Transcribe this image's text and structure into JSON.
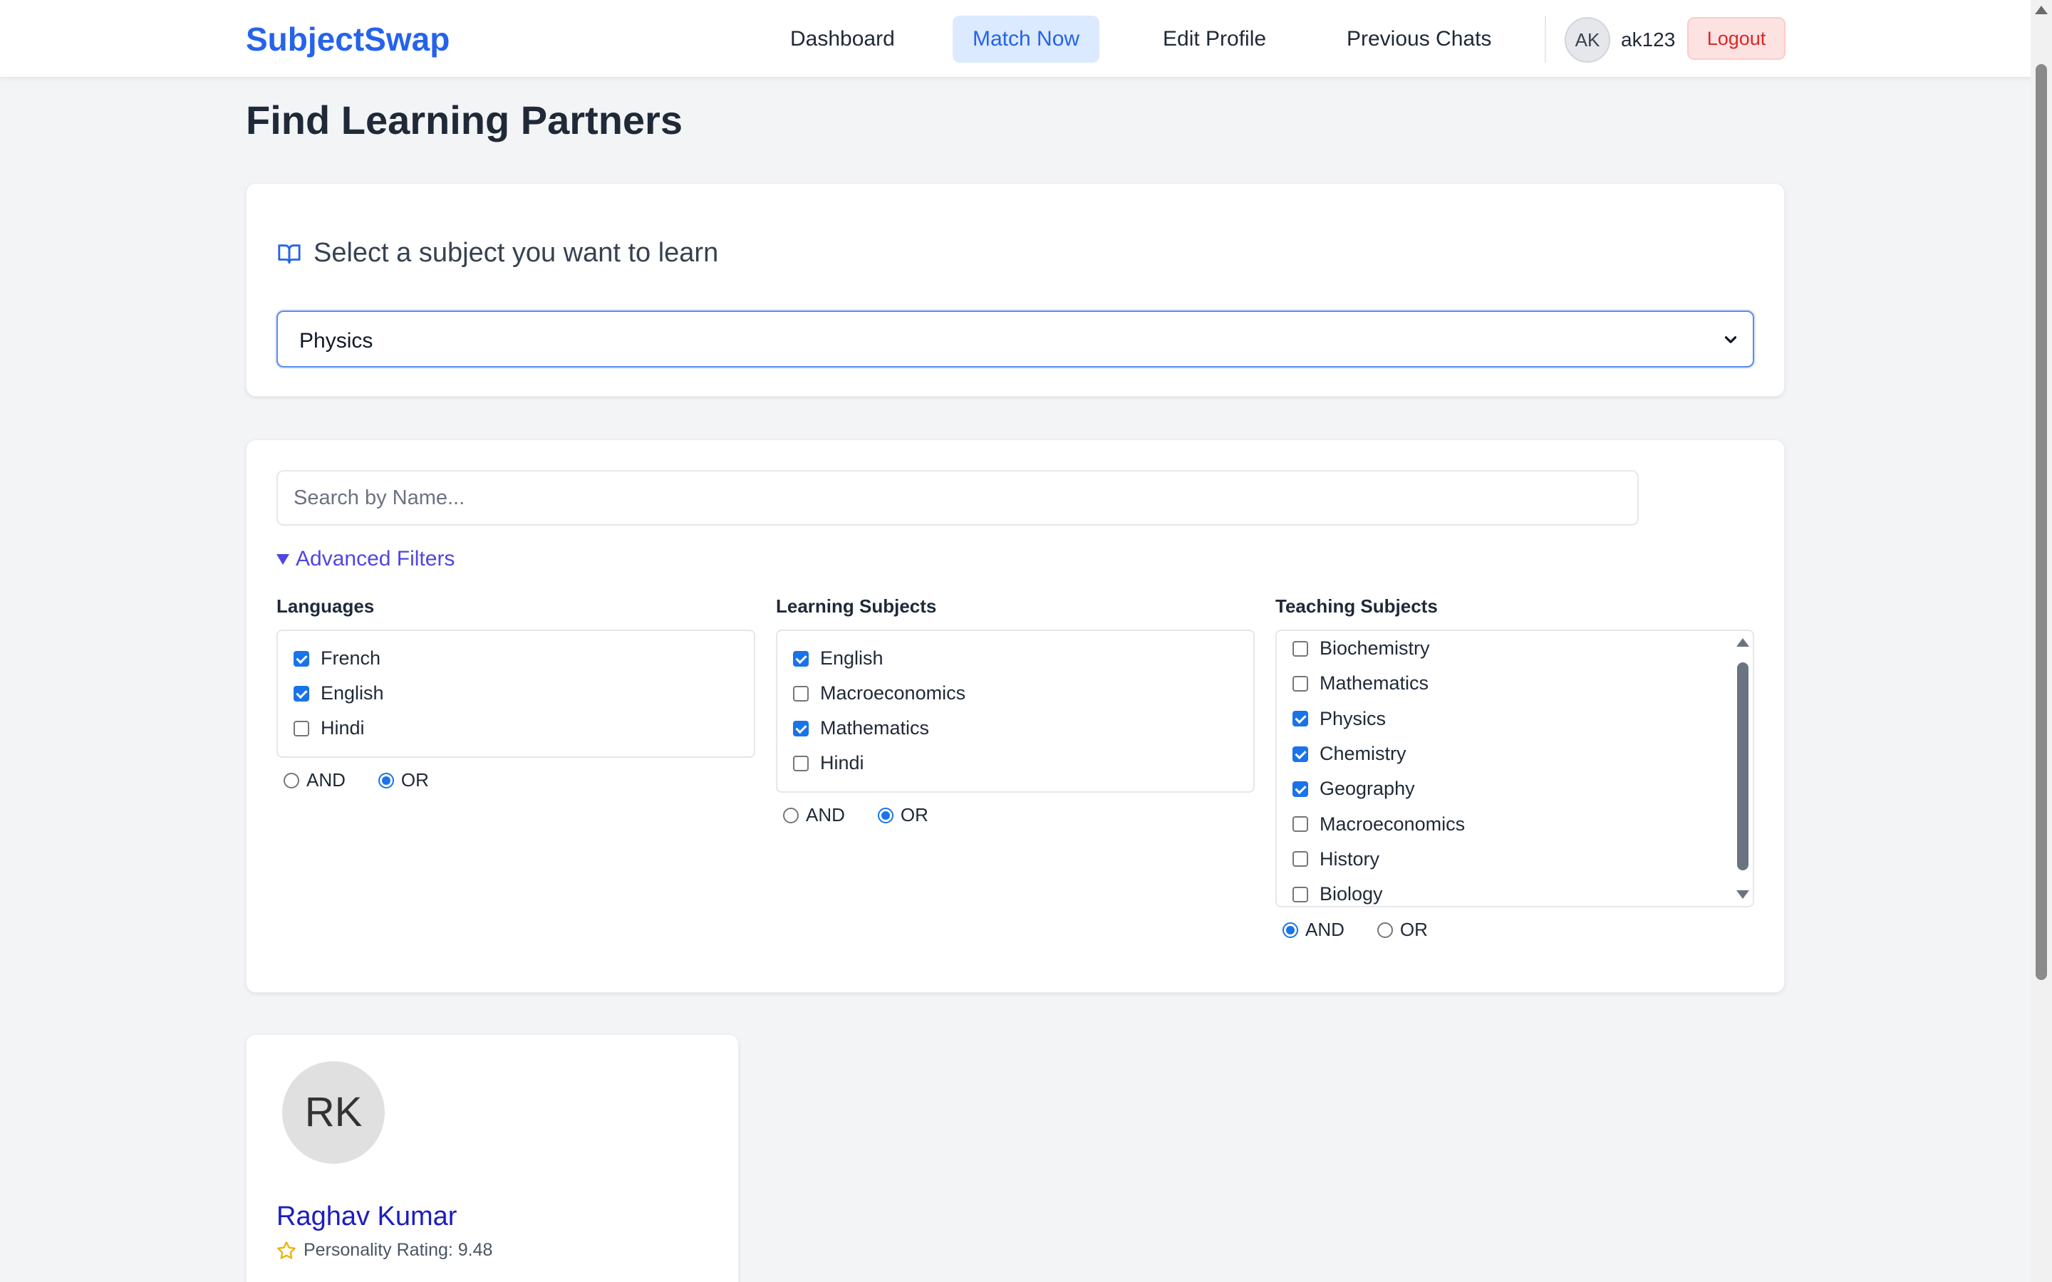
{
  "nav": {
    "brand": "SubjectSwap",
    "links": [
      {
        "label": "Dashboard"
      },
      {
        "label": "Match Now"
      },
      {
        "label": "Edit Profile"
      },
      {
        "label": "Previous Chats"
      }
    ],
    "user_initials": "AK",
    "username": "ak123",
    "logout_label": "Logout"
  },
  "page": {
    "title": "Find Learning Partners"
  },
  "subject_select": {
    "heading": "Select a subject you want to learn",
    "selected": "Physics"
  },
  "filters": {
    "search_placeholder": "Search by Name...",
    "advanced_label": "Advanced Filters",
    "languages": {
      "label": "Languages",
      "options": [
        {
          "label": "French",
          "checked": true
        },
        {
          "label": "English",
          "checked": true
        },
        {
          "label": "Hindi",
          "checked": false
        }
      ],
      "mode": "OR"
    },
    "learning": {
      "label": "Learning Subjects",
      "options": [
        {
          "label": "English",
          "checked": true
        },
        {
          "label": "Macroeconomics",
          "checked": false
        },
        {
          "label": "Mathematics",
          "checked": true
        },
        {
          "label": "Hindi",
          "checked": false
        }
      ],
      "mode": "OR"
    },
    "teaching": {
      "label": "Teaching Subjects",
      "options": [
        {
          "label": "Biochemistry",
          "checked": false
        },
        {
          "label": "Mathematics",
          "checked": false
        },
        {
          "label": "Physics",
          "checked": true
        },
        {
          "label": "Chemistry",
          "checked": true
        },
        {
          "label": "Geography",
          "checked": true
        },
        {
          "label": "Macroeconomics",
          "checked": false
        },
        {
          "label": "History",
          "checked": false
        },
        {
          "label": "Biology",
          "checked": false
        }
      ],
      "mode": "AND"
    },
    "and_label": "AND",
    "or_label": "OR"
  },
  "results": [
    {
      "initials": "RK",
      "name": "Raghav Kumar",
      "rating_text": "Personality Rating: 9.48"
    }
  ],
  "colors": {
    "brand": "#2563eb",
    "accent_link": "#4f46e5",
    "logout": "#dc2626",
    "checkbox": "#1a73e8"
  }
}
